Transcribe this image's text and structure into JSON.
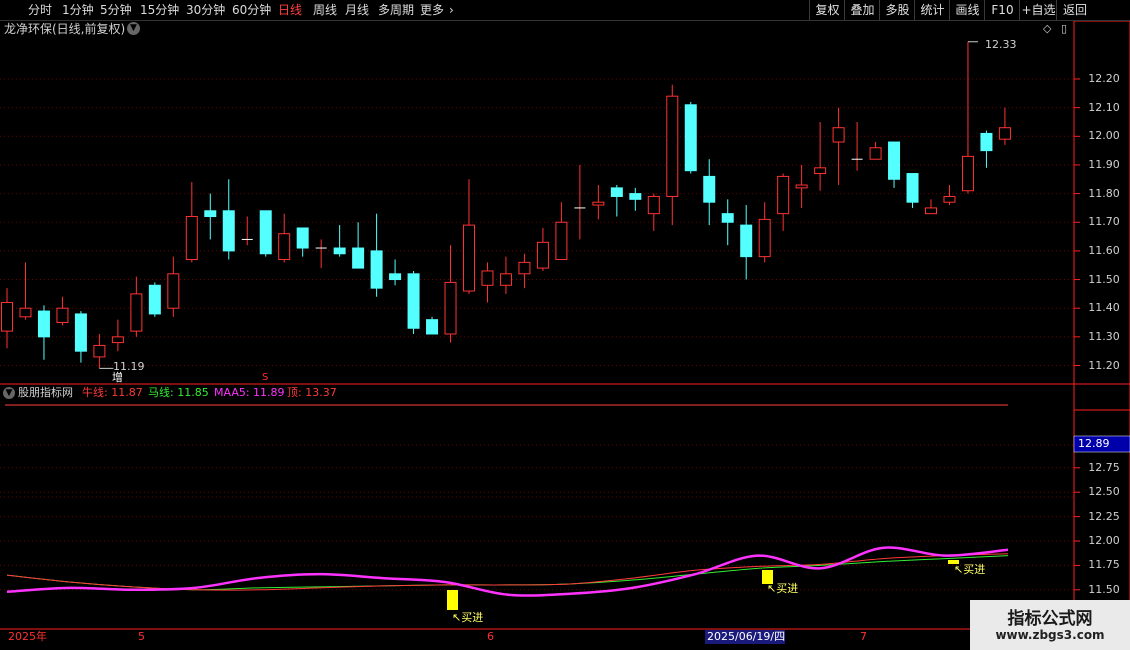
{
  "toolbar": {
    "periods": [
      "分时",
      "1分钟",
      "5分钟",
      "15分钟",
      "30分钟",
      "60分钟",
      "日线",
      "周线",
      "月线",
      "多周期",
      "更多"
    ],
    "active": "日线",
    "right_buttons": [
      "复权",
      "叠加",
      "多股",
      "统计",
      "画线",
      "F10",
      "+自选",
      "返回"
    ]
  },
  "main_title": "龙净环保(日线,前复权)",
  "indicator": {
    "name": "股朋指标网",
    "lines": [
      {
        "label": "牛线:",
        "value": "11.87",
        "color": "#ff3a3a"
      },
      {
        "label": "马线:",
        "value": "11.85",
        "color": "#33ee33"
      },
      {
        "label": "MAA5:",
        "value": "11.89",
        "color": "#ff33ff"
      },
      {
        "label": "顶:",
        "value": "13.37",
        "color": "#ff3a3a"
      }
    ],
    "current_value": "12.89",
    "signal_label": "↖买进"
  },
  "annotations": {
    "high": "12.33",
    "low": "11.19",
    "tag_zeng": "增",
    "tag_s": "S"
  },
  "y_axis_main": [
    "12.20",
    "12.10",
    "12.00",
    "11.90",
    "11.80",
    "11.70",
    "11.60",
    "11.50",
    "11.40",
    "11.30",
    "11.20"
  ],
  "y_axis_ind": [
    "12.75",
    "12.50",
    "12.25",
    "12.00",
    "11.75",
    "11.50"
  ],
  "x_axis": {
    "labels": [
      "2025年",
      "5",
      "6",
      "7"
    ],
    "cursor_date": "2025/06/19/四"
  },
  "watermark": {
    "line1": "指标公式网",
    "line2": "www.zbgs3.com"
  },
  "chart_data": {
    "type": "candlestick",
    "candles": [
      [
        11.32,
        11.42,
        11.47,
        11.26
      ],
      [
        11.37,
        11.4,
        11.56,
        11.36
      ],
      [
        11.39,
        11.3,
        11.41,
        11.22
      ],
      [
        11.35,
        11.4,
        11.44,
        11.34
      ],
      [
        11.38,
        11.25,
        11.39,
        11.21
      ],
      [
        11.23,
        11.27,
        11.31,
        11.19
      ],
      [
        11.28,
        11.3,
        11.36,
        11.25
      ],
      [
        11.32,
        11.45,
        11.51,
        11.3
      ],
      [
        11.48,
        11.38,
        11.49,
        11.37
      ],
      [
        11.4,
        11.52,
        11.58,
        11.37
      ],
      [
        11.57,
        11.72,
        11.84,
        11.56
      ],
      [
        11.74,
        11.72,
        11.8,
        11.64
      ],
      [
        11.74,
        11.6,
        11.85,
        11.57
      ],
      [
        11.64,
        11.64,
        11.72,
        11.62
      ],
      [
        11.74,
        11.59,
        11.74,
        11.58
      ],
      [
        11.57,
        11.66,
        11.73,
        11.56
      ],
      [
        11.68,
        11.61,
        11.68,
        11.58
      ],
      [
        11.61,
        11.61,
        11.64,
        11.54
      ],
      [
        11.61,
        11.59,
        11.69,
        11.58
      ],
      [
        11.61,
        11.54,
        11.7,
        11.54
      ],
      [
        11.6,
        11.47,
        11.73,
        11.44
      ],
      [
        11.52,
        11.5,
        11.57,
        11.48
      ],
      [
        11.52,
        11.33,
        11.53,
        11.31
      ],
      [
        11.36,
        11.31,
        11.37,
        11.31
      ],
      [
        11.31,
        11.49,
        11.62,
        11.28
      ],
      [
        11.46,
        11.69,
        11.85,
        11.45
      ],
      [
        11.48,
        11.53,
        11.56,
        11.42
      ],
      [
        11.48,
        11.52,
        11.58,
        11.45
      ],
      [
        11.52,
        11.56,
        11.59,
        11.47
      ],
      [
        11.54,
        11.63,
        11.68,
        11.53
      ],
      [
        11.57,
        11.7,
        11.77,
        11.57
      ],
      [
        11.75,
        11.75,
        11.9,
        11.64
      ],
      [
        11.76,
        11.77,
        11.83,
        11.71
      ],
      [
        11.82,
        11.79,
        11.83,
        11.72
      ],
      [
        11.8,
        11.78,
        11.82,
        11.74
      ],
      [
        11.73,
        11.79,
        11.8,
        11.67
      ],
      [
        11.79,
        12.14,
        12.18,
        11.69
      ],
      [
        12.11,
        11.88,
        12.12,
        11.87
      ],
      [
        11.86,
        11.77,
        11.92,
        11.69
      ],
      [
        11.73,
        11.7,
        11.78,
        11.62
      ],
      [
        11.69,
        11.58,
        11.76,
        11.5
      ],
      [
        11.58,
        11.71,
        11.77,
        11.56
      ],
      [
        11.73,
        11.86,
        11.87,
        11.67
      ],
      [
        11.82,
        11.83,
        11.9,
        11.75
      ],
      [
        11.87,
        11.89,
        12.05,
        11.81
      ],
      [
        11.98,
        12.03,
        12.1,
        11.83
      ],
      [
        11.92,
        11.92,
        12.05,
        11.88
      ],
      [
        11.92,
        11.96,
        11.98,
        11.92
      ],
      [
        11.98,
        11.85,
        11.98,
        11.82
      ],
      [
        11.87,
        11.77,
        11.87,
        11.75
      ],
      [
        11.73,
        11.75,
        11.78,
        11.73
      ],
      [
        11.77,
        11.79,
        11.83,
        11.76
      ],
      [
        11.81,
        11.93,
        12.33,
        11.8
      ],
      [
        12.01,
        11.95,
        12.02,
        11.89
      ],
      [
        11.99,
        12.03,
        12.1,
        11.97
      ]
    ],
    "indicator_series": {
      "niu": [
        11.65,
        11.58,
        11.53,
        11.5,
        11.5,
        11.52,
        11.54,
        11.55,
        11.55,
        11.56,
        11.62,
        11.7,
        11.74,
        11.76,
        11.82,
        11.85,
        11.87
      ],
      "ma": [
        11.65,
        11.58,
        11.53,
        11.5,
        11.52,
        11.53,
        11.54,
        11.55,
        11.55,
        11.56,
        11.6,
        11.66,
        11.72,
        11.75,
        11.79,
        11.82,
        11.85
      ],
      "maa5": [
        11.48,
        11.52,
        11.5,
        11.52,
        11.62,
        11.66,
        11.62,
        11.58,
        11.45,
        11.46,
        11.52,
        11.66,
        11.85,
        11.72,
        11.93,
        11.85,
        11.91
      ]
    }
  }
}
